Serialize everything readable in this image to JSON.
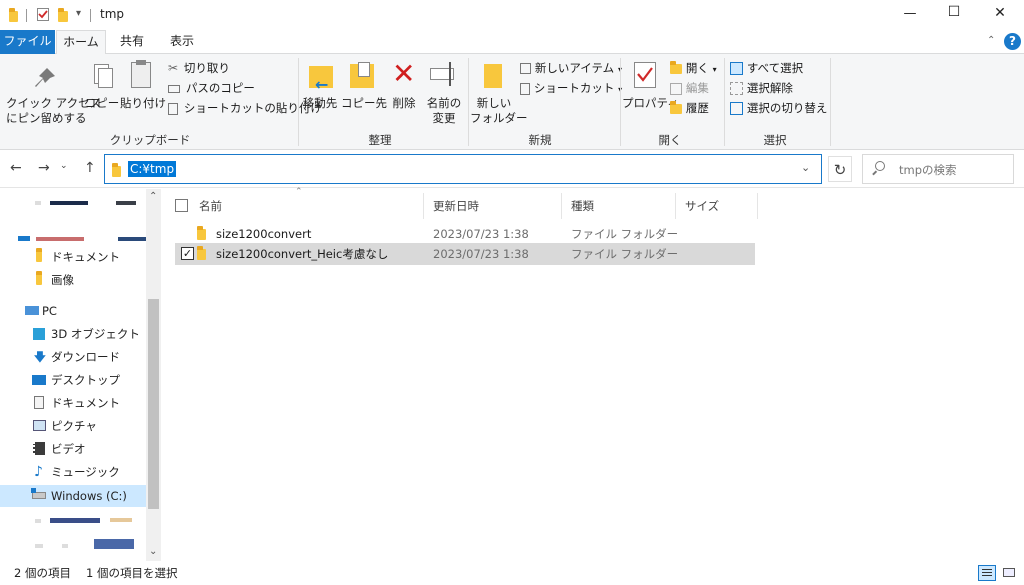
{
  "window": {
    "title": "tmp",
    "minimize_glyph": "—",
    "maximize_glyph": "☐",
    "close_glyph": "✕",
    "qat_dropdown_glyph": "▾"
  },
  "tabs": [
    {
      "label": "ファイル"
    },
    {
      "label": "ホーム"
    },
    {
      "label": "共有"
    },
    {
      "label": "表示"
    }
  ],
  "ribbon_help_glyph": "?",
  "ribbon": {
    "clipboard": {
      "pin_label_1": "クイック アクセス",
      "pin_label_2": "にピン留めする",
      "copy": "コピー",
      "paste": "貼り付け",
      "cut": "切り取り",
      "copy_path": "パスのコピー",
      "paste_shortcut": "ショートカットの貼り付け",
      "group": "クリップボード"
    },
    "organize": {
      "move_to": "移動先",
      "copy_to": "コピー先",
      "delete": "削除",
      "rename_1": "名前の",
      "rename_2": "変更",
      "group": "整理"
    },
    "new": {
      "new_folder_1": "新しい",
      "new_folder_2": "フォルダー",
      "new_item": "新しいアイテム",
      "easy_access": "ショートカット",
      "group": "新規"
    },
    "open": {
      "properties": "プロパティ",
      "open": "開く",
      "edit": "編集",
      "history": "履歴",
      "group": "開く"
    },
    "select": {
      "select_all": "すべて選択",
      "select_none": "選択解除",
      "invert": "選択の切り替え",
      "group": "選択"
    }
  },
  "address": {
    "path": "C:¥tmp",
    "search_placeholder": "tmpの検索",
    "back": "←",
    "forward": "→",
    "up": "↑",
    "refresh": "↻",
    "dropdown": "⌄"
  },
  "nav": {
    "items": [
      {
        "label": "ドキュメント"
      },
      {
        "label": "画像"
      },
      {
        "label": "PC"
      },
      {
        "label": "3D オブジェクト"
      },
      {
        "label": "ダウンロード"
      },
      {
        "label": "デスクトップ"
      },
      {
        "label": "ドキュメント"
      },
      {
        "label": "ピクチャ"
      },
      {
        "label": "ビデオ"
      },
      {
        "label": "ミュージック"
      },
      {
        "label": "Windows (C:)"
      }
    ]
  },
  "columns": {
    "name": "名前",
    "modified": "更新日時",
    "type": "種類",
    "size": "サイズ"
  },
  "files": [
    {
      "name": "size1200convert",
      "modified": "2023/07/23 1:38",
      "type": "ファイル フォルダー",
      "size": "",
      "selected": false
    },
    {
      "name": "size1200convert_Heic考慮なし",
      "modified": "2023/07/23 1:38",
      "type": "ファイル フォルダー",
      "size": "",
      "selected": true
    }
  ],
  "status": {
    "item_count": "2 個の項目",
    "selected_count": "1 個の項目を選択"
  },
  "colors": {
    "accent": "#1979ca",
    "file_tab": "#1979ca",
    "selection": "#cce8ff",
    "selected_row": "#d9d9d9",
    "folder": "#f8c73d"
  },
  "icons": [
    "folder-icon",
    "pin-icon",
    "copy-icon",
    "paste-icon",
    "scissors-icon",
    "delete-icon",
    "properties-icon",
    "search-icon",
    "refresh-icon",
    "pc-icon",
    "drive-icon",
    "music-icon",
    "video-icon",
    "pictures-icon",
    "download-icon",
    "desktop-icon",
    "3d-icon"
  ]
}
